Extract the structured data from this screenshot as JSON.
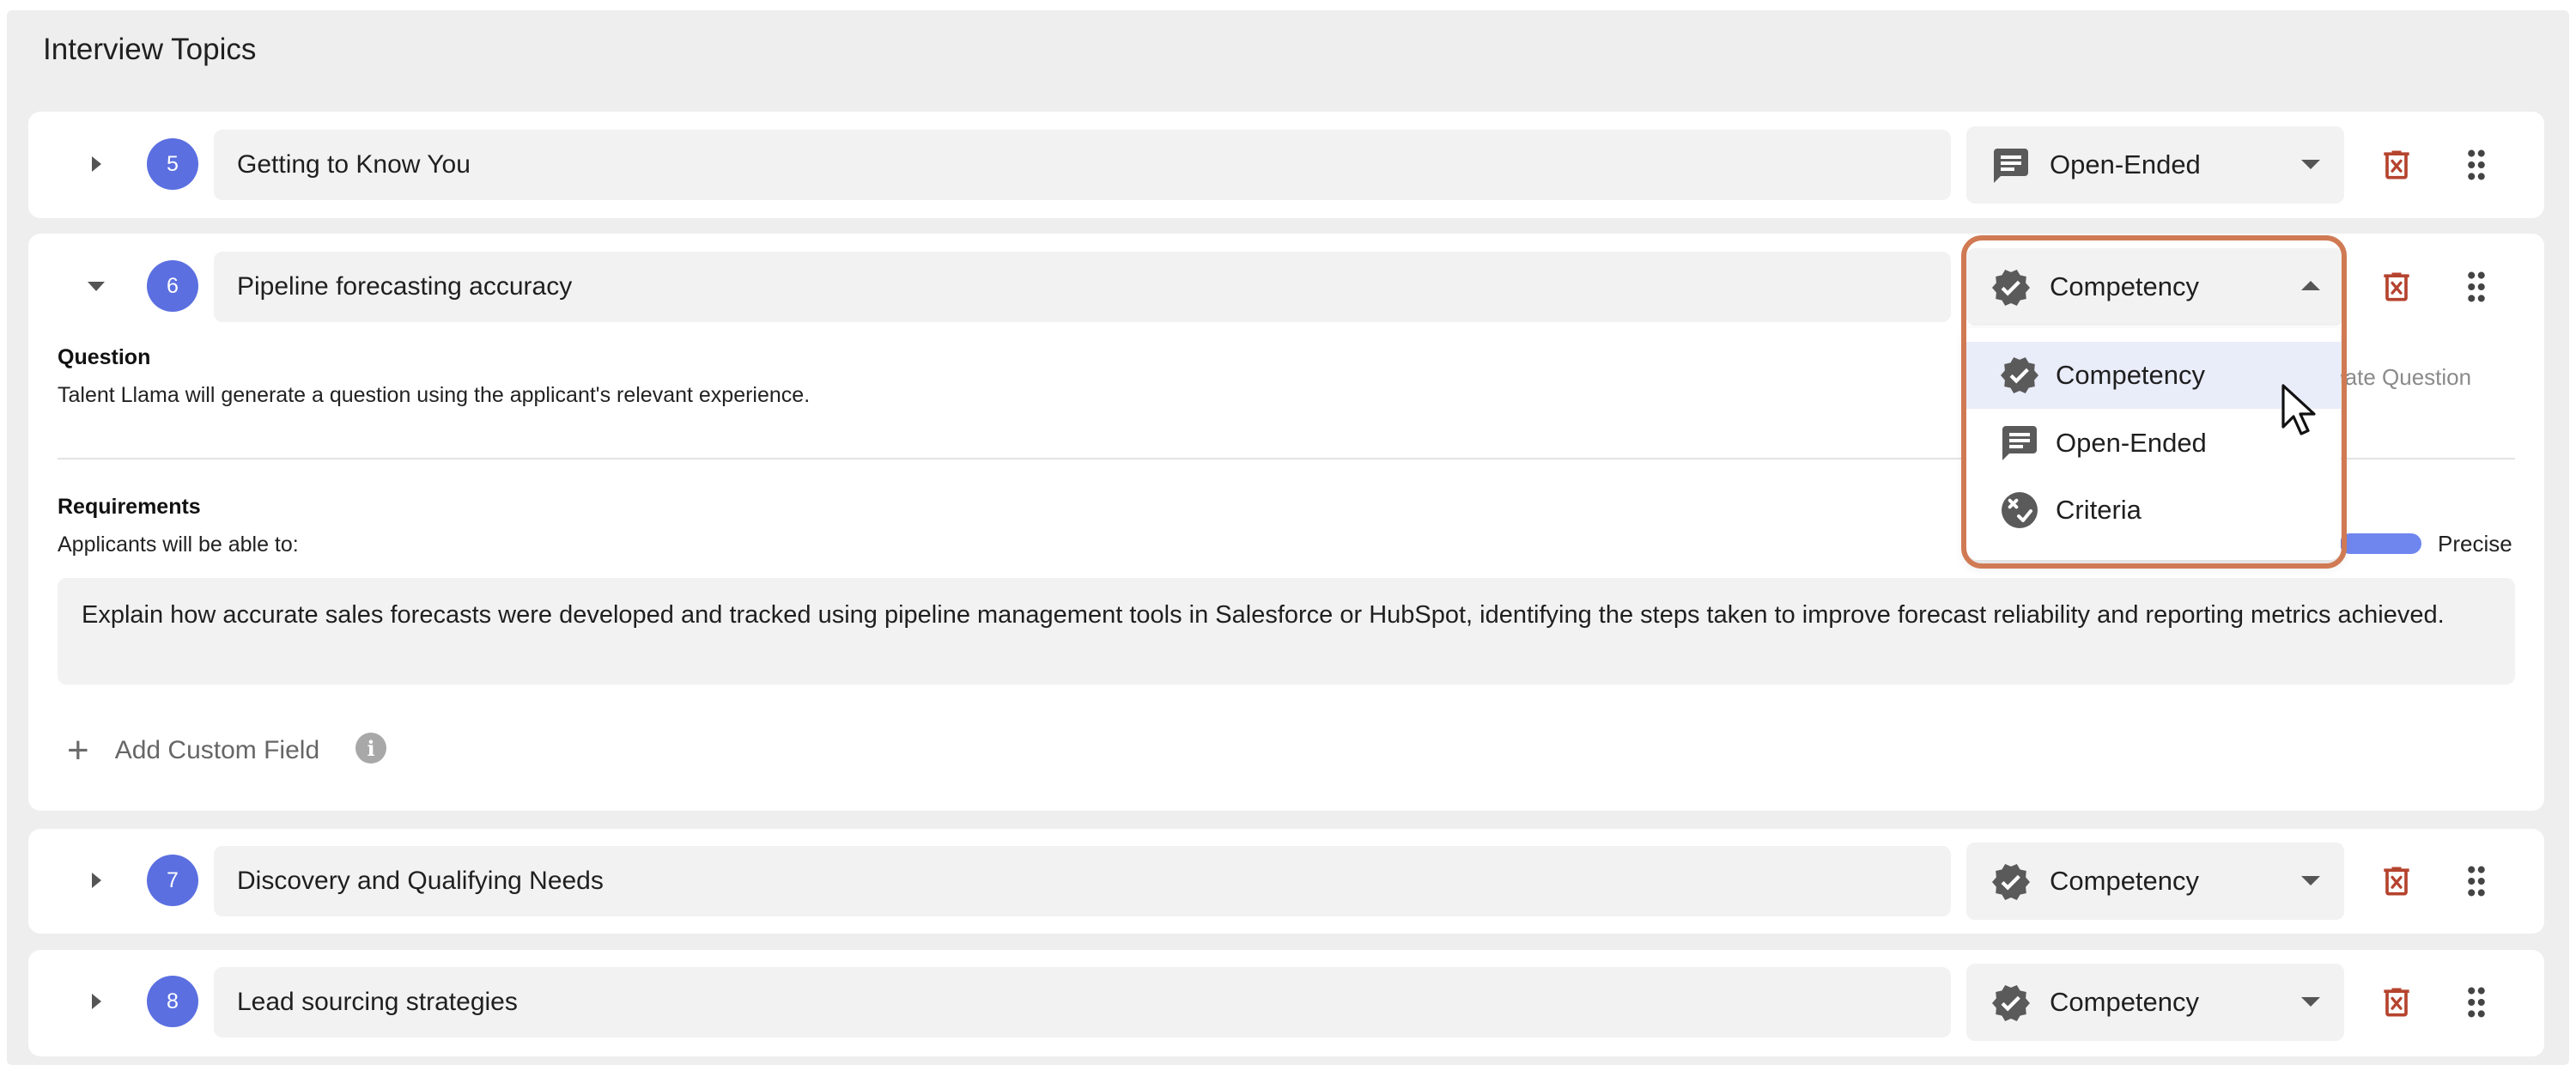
{
  "section": {
    "title": "Interview Topics"
  },
  "topics": [
    {
      "number": "5",
      "title": "Getting to Know You",
      "type": "Open-Ended",
      "type_icon": "chat-icon",
      "expanded": false
    },
    {
      "number": "6",
      "title": "Pipeline forecasting accuracy",
      "type": "Competency",
      "type_icon": "verified-badge-icon",
      "expanded": true
    },
    {
      "number": "7",
      "title": "Discovery and Qualifying Needs",
      "type": "Competency",
      "type_icon": "verified-badge-icon",
      "expanded": false
    },
    {
      "number": "8",
      "title": "Lead sourcing strategies",
      "type": "Competency",
      "type_icon": "verified-badge-icon",
      "expanded": false
    }
  ],
  "expanded_topic": {
    "question_heading": "Question",
    "question_text": "Talent Llama will generate a question using the applicant's relevant experience.",
    "generate_button_partial": "rate Question",
    "requirements_heading": "Requirements",
    "requirements_subtext": "Applicants will be able to:",
    "slider_end_label": "Precise",
    "requirement_text": "Explain how accurate sales forecasts were developed and tracked using pipeline management tools in Salesforce or HubSpot, identifying the steps taken to improve forecast reliability and reporting metrics achieved.",
    "add_custom_field_label": "Add Custom Field"
  },
  "type_dropdown": {
    "open": true,
    "selected": "Competency",
    "options": [
      {
        "label": "Competency",
        "icon": "verified-badge-icon",
        "hovered": true
      },
      {
        "label": "Open-Ended",
        "icon": "chat-icon",
        "hovered": false
      },
      {
        "label": "Criteria",
        "icon": "criteria-check-icon",
        "hovered": false
      }
    ]
  },
  "colors": {
    "badge": "#5b6fe0",
    "delete_icon": "#b5432e",
    "highlight_outline": "#d07a54",
    "hover_row": "#e9ecf9",
    "slider": "#6f86ef"
  }
}
